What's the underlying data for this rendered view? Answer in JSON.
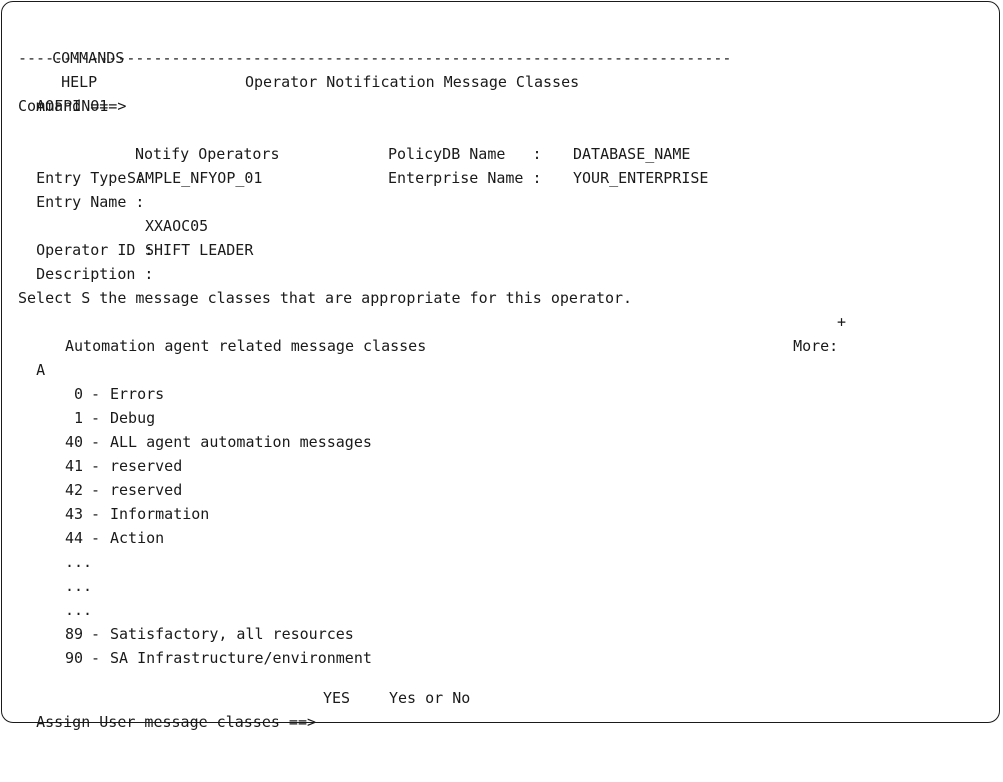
{
  "menu": {
    "commands": "COMMANDS",
    "help": "HELP"
  },
  "separator": "-------------------------------------------------------------------------------",
  "panel": {
    "id": "AOFPINO1",
    "title": "Operator Notification Message Classes"
  },
  "command": {
    "label": "Command ===>",
    "value": ""
  },
  "entry": {
    "type_label": "Entry Type :",
    "type_value": "Notify Operators",
    "name_label": "Entry Name :",
    "name_value": "SAMPLE_NFYOP_01",
    "policydb_label": "PolicyDB Name   :",
    "policydb_value": "DATABASE_NAME",
    "enterprise_label": "Enterprise Name :",
    "enterprise_value": "YOUR_ENTERPRISE"
  },
  "operator": {
    "id_label": "Operator ID :",
    "id_value": "XXAOC05",
    "desc_label": "Description :",
    "desc_value": "SHIFT LEADER"
  },
  "instruction": "Select S the message classes that are appropriate for this operator.",
  "more": {
    "label": "More:",
    "indicator": "+"
  },
  "group": {
    "code": "A",
    "title": "Automation agent related message classes"
  },
  "classes": [
    {
      "num": "0",
      "desc": "Errors"
    },
    {
      "num": "1",
      "desc": "Debug"
    },
    {
      "num": "40",
      "desc": "ALL agent automation messages"
    },
    {
      "num": "41",
      "desc": "reserved"
    },
    {
      "num": "42",
      "desc": "reserved"
    },
    {
      "num": "43",
      "desc": "Information"
    },
    {
      "num": "44",
      "desc": "Action"
    },
    {
      "ellipsis": "..."
    },
    {
      "ellipsis": "..."
    },
    {
      "ellipsis": "..."
    },
    {
      "num": "89",
      "desc": "Satisfactory, all resources"
    },
    {
      "num": "90",
      "desc": "SA Infrastructure/environment"
    }
  ],
  "assign": {
    "label": "Assign User message classes ==>",
    "value": "YES",
    "hint": "Yes or No"
  }
}
